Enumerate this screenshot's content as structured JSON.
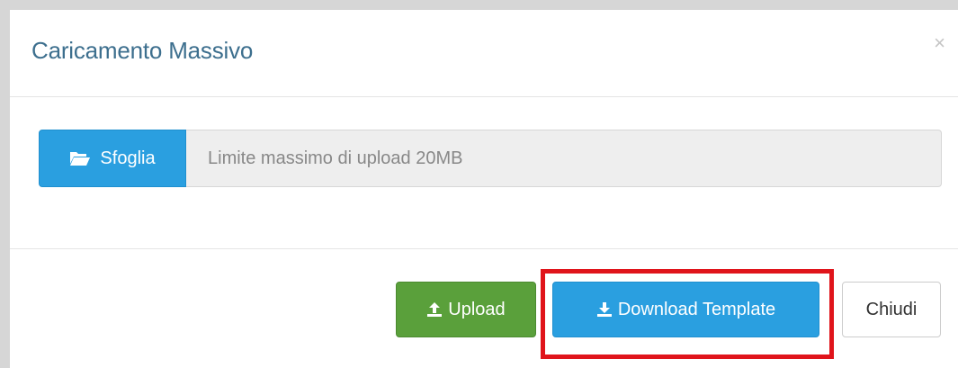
{
  "dialog": {
    "title": "Caricamento Massivo",
    "close_symbol": "×"
  },
  "body": {
    "browse_label": "Sfoglia",
    "browse_icon": "folder-open-icon",
    "file_placeholder": "Limite massimo di upload 20MB"
  },
  "footer": {
    "upload_label": "Upload",
    "upload_icon": "upload-icon",
    "download_label": "Download Template",
    "download_icon": "download-icon",
    "close_label": "Chiudi"
  },
  "colors": {
    "title": "#3d6f8e",
    "primary": "#2a9fe0",
    "success": "#5aa03b",
    "highlight": "#e0141b"
  }
}
